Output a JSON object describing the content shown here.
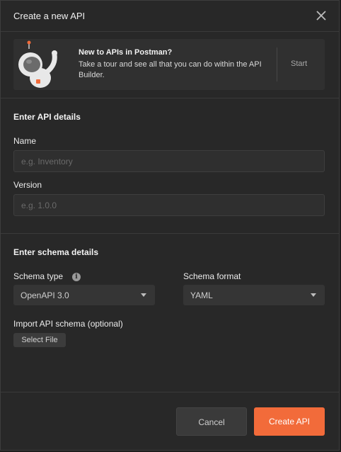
{
  "dialog": {
    "title": "Create a new API",
    "close_icon": "close-icon"
  },
  "banner": {
    "illustration": "astronaut-illustration",
    "title": "New to APIs in Postman?",
    "text": "Take a tour and see all that you can do within the API Builder.",
    "start_label": "Start"
  },
  "api_details": {
    "heading": "Enter API details",
    "name_label": "Name",
    "name_placeholder": "e.g. Inventory",
    "name_value": "",
    "version_label": "Version",
    "version_placeholder": "e.g. 1.0.0",
    "version_value": ""
  },
  "schema_details": {
    "heading": "Enter schema details",
    "type_label": "Schema type",
    "type_info_icon": "info-icon",
    "type_value": "OpenAPI 3.0",
    "format_label": "Schema format",
    "format_value": "YAML",
    "import_label": "Import API schema (optional)",
    "select_file_label": "Select File"
  },
  "footer": {
    "cancel_label": "Cancel",
    "create_label": "Create API"
  },
  "colors": {
    "accent": "#f26b3a",
    "background": "#282828",
    "input_bg": "#2f2f2f"
  }
}
